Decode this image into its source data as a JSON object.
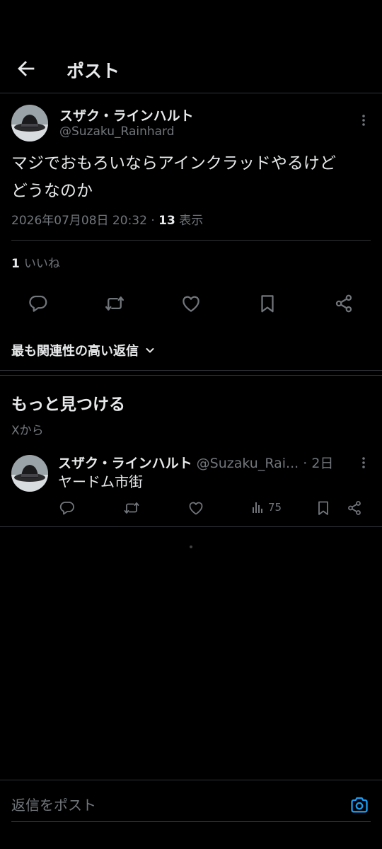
{
  "header": {
    "title": "ポスト"
  },
  "post": {
    "author_name": "スザク・ラインハルト",
    "author_handle": "@Suzaku_Rainhard",
    "text_line1": "マジでおもろいならアインクラッドやるけど",
    "text_line2": "どうなのか",
    "timestamp": "2026年07月08日 20:32",
    "views_count": "13",
    "views_label": "表示",
    "likes_count": "1",
    "likes_label": "いいね"
  },
  "sort": {
    "label": "最も関連性の高い返信"
  },
  "discover": {
    "title": "もっと見つける",
    "subtitle": "Xから",
    "post": {
      "author_name": "スザク・ラインハルト",
      "author_handle": "@Suzaku_Rai...",
      "time": "· 2日",
      "text": "ヤードム市街",
      "views": "75"
    }
  },
  "reply": {
    "placeholder": "返信をポスト"
  },
  "colors": {
    "background": "#000000",
    "text": "#e7e9ea",
    "secondary": "#71767b",
    "accent": "#1d9bf0",
    "divider": "#2f3336"
  },
  "icons": [
    "back-arrow-icon",
    "more-dots-icon",
    "reply-icon",
    "repost-icon",
    "like-icon",
    "bookmark-icon",
    "share-icon",
    "views-icon",
    "camera-icon",
    "chevron-down-icon"
  ]
}
